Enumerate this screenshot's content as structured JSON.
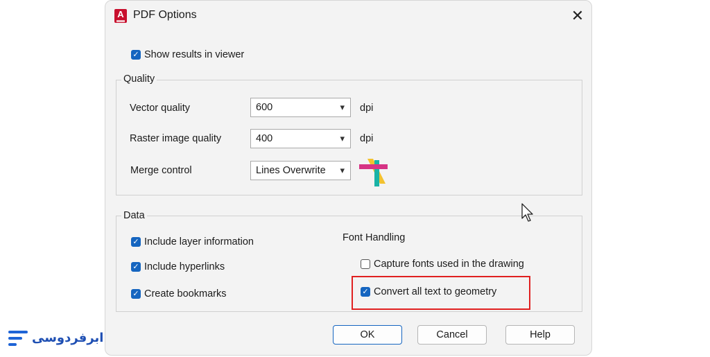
{
  "dialog": {
    "title": "PDF Options",
    "app_icon_letter": "A",
    "close_glyph": "✕"
  },
  "show_results": {
    "label": "Show results in viewer",
    "checked": true
  },
  "quality": {
    "group_title": "Quality",
    "vector_label": "Vector quality",
    "vector_value": "600",
    "vector_unit": "dpi",
    "raster_label": "Raster image quality",
    "raster_value": "400",
    "raster_unit": "dpi",
    "merge_label": "Merge control",
    "merge_value": "Lines Overwrite",
    "merge_icon": "lines-overwrite-icon"
  },
  "data": {
    "group_title": "Data",
    "include_layer": {
      "label": "Include layer information",
      "checked": true
    },
    "include_hyperlinks": {
      "label": "Include hyperlinks",
      "checked": true
    },
    "create_bookmarks": {
      "label": "Create bookmarks",
      "checked": true
    },
    "font_handling_title": "Font Handling",
    "capture_fonts": {
      "label": "Capture fonts used in the drawing",
      "checked": false
    },
    "convert_text": {
      "label": "Convert all text to geometry",
      "checked": true
    }
  },
  "buttons": {
    "ok": "OK",
    "cancel": "Cancel",
    "help": "Help"
  },
  "brand": {
    "text": "ابرفردوسی"
  },
  "colors": {
    "accent": "#1565c0",
    "highlight": "#e02020",
    "app_icon": "#c8102e"
  },
  "icons": {
    "chevron": "▾",
    "check": "✓"
  }
}
